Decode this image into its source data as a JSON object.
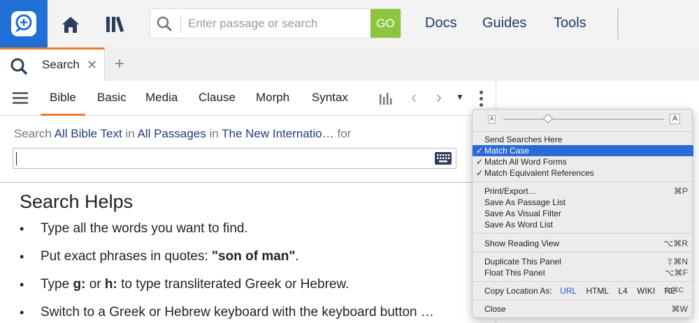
{
  "topbar": {
    "search_placeholder": "Enter passage or search",
    "go_label": "GO",
    "nav": [
      "Docs",
      "Guides",
      "Tools"
    ]
  },
  "tabs": {
    "active_label": "Search",
    "close_glyph": "✕",
    "add_glyph": "+"
  },
  "search_tabs": [
    "Bible",
    "Basic",
    "Media",
    "Clause",
    "Morph",
    "Syntax"
  ],
  "criteria": {
    "prefix": "Search",
    "scope": "All Bible Text",
    "in1": "in",
    "passages": "All Passages",
    "in2": "in",
    "version": "The New Internatio…",
    "suffix": "for"
  },
  "query_value": "",
  "helps": {
    "title": "Search Helps",
    "items": [
      {
        "t1": "Type all the words you want to find.",
        "b": "",
        "t2": ""
      },
      {
        "t1": "Put exact phrases in quotes: ",
        "b": "\"son of man\"",
        "t2": "."
      },
      {
        "t1": "Type ",
        "b": "g:",
        "t2": " or "
      },
      {
        "t1": "Switch to a Greek or Hebrew keyboard with the keyboard button …",
        "b": "",
        "t2": ""
      }
    ],
    "item3": {
      "pre": "Type ",
      "b1": "g:",
      "mid": " or ",
      "b2": "h:",
      "post": " to type transliterated Greek or Hebrew."
    }
  },
  "menu": {
    "font_small": "A",
    "font_large": "A",
    "items": [
      {
        "label": "Send Searches Here",
        "check": "",
        "shortcut": ""
      },
      {
        "label": "Match Case",
        "check": "✓",
        "shortcut": "",
        "selected": true
      },
      {
        "label": "Match All Word Forms",
        "check": "✓",
        "shortcut": ""
      },
      {
        "label": "Match Equivalent References",
        "check": "✓",
        "shortcut": ""
      },
      {
        "label": "Print/Export…",
        "check": "",
        "shortcut": "⌘P"
      },
      {
        "label": "Save As Passage List",
        "check": "",
        "shortcut": ""
      },
      {
        "label": "Save As Visual Filter",
        "check": "",
        "shortcut": ""
      },
      {
        "label": "Save As Word List",
        "check": "",
        "shortcut": ""
      },
      {
        "label": "Show Reading View",
        "check": "",
        "shortcut": "⌥⌘R"
      },
      {
        "label": "Duplicate This Panel",
        "check": "",
        "shortcut": "⇧⌘N"
      },
      {
        "label": "Float This Panel",
        "check": "",
        "shortcut": "⌥⌘F"
      },
      {
        "label": "Close",
        "check": "",
        "shortcut": "⌘W"
      }
    ],
    "copy_location": {
      "label": "Copy Location As:",
      "options": [
        "URL",
        "HTML",
        "L4",
        "WIKI",
        "RL"
      ],
      "shortcut": "⌥⌘C"
    }
  },
  "colors": {
    "brand_blue": "#1f6fd6",
    "go_green": "#8cc63f",
    "active_tab_accent": "#f07a2a",
    "menu_selection": "#2a6cd7"
  },
  "icons": {
    "logo": "logos-bible-search-icon",
    "home": "home-icon",
    "library": "library-icon",
    "search": "search-icon",
    "menu": "hamburger-icon",
    "chart": "bar-chart-icon",
    "back": "chevron-left-icon",
    "forward": "chevron-right-icon",
    "more": "kebab-icon",
    "keyboard": "keyboard-icon"
  }
}
